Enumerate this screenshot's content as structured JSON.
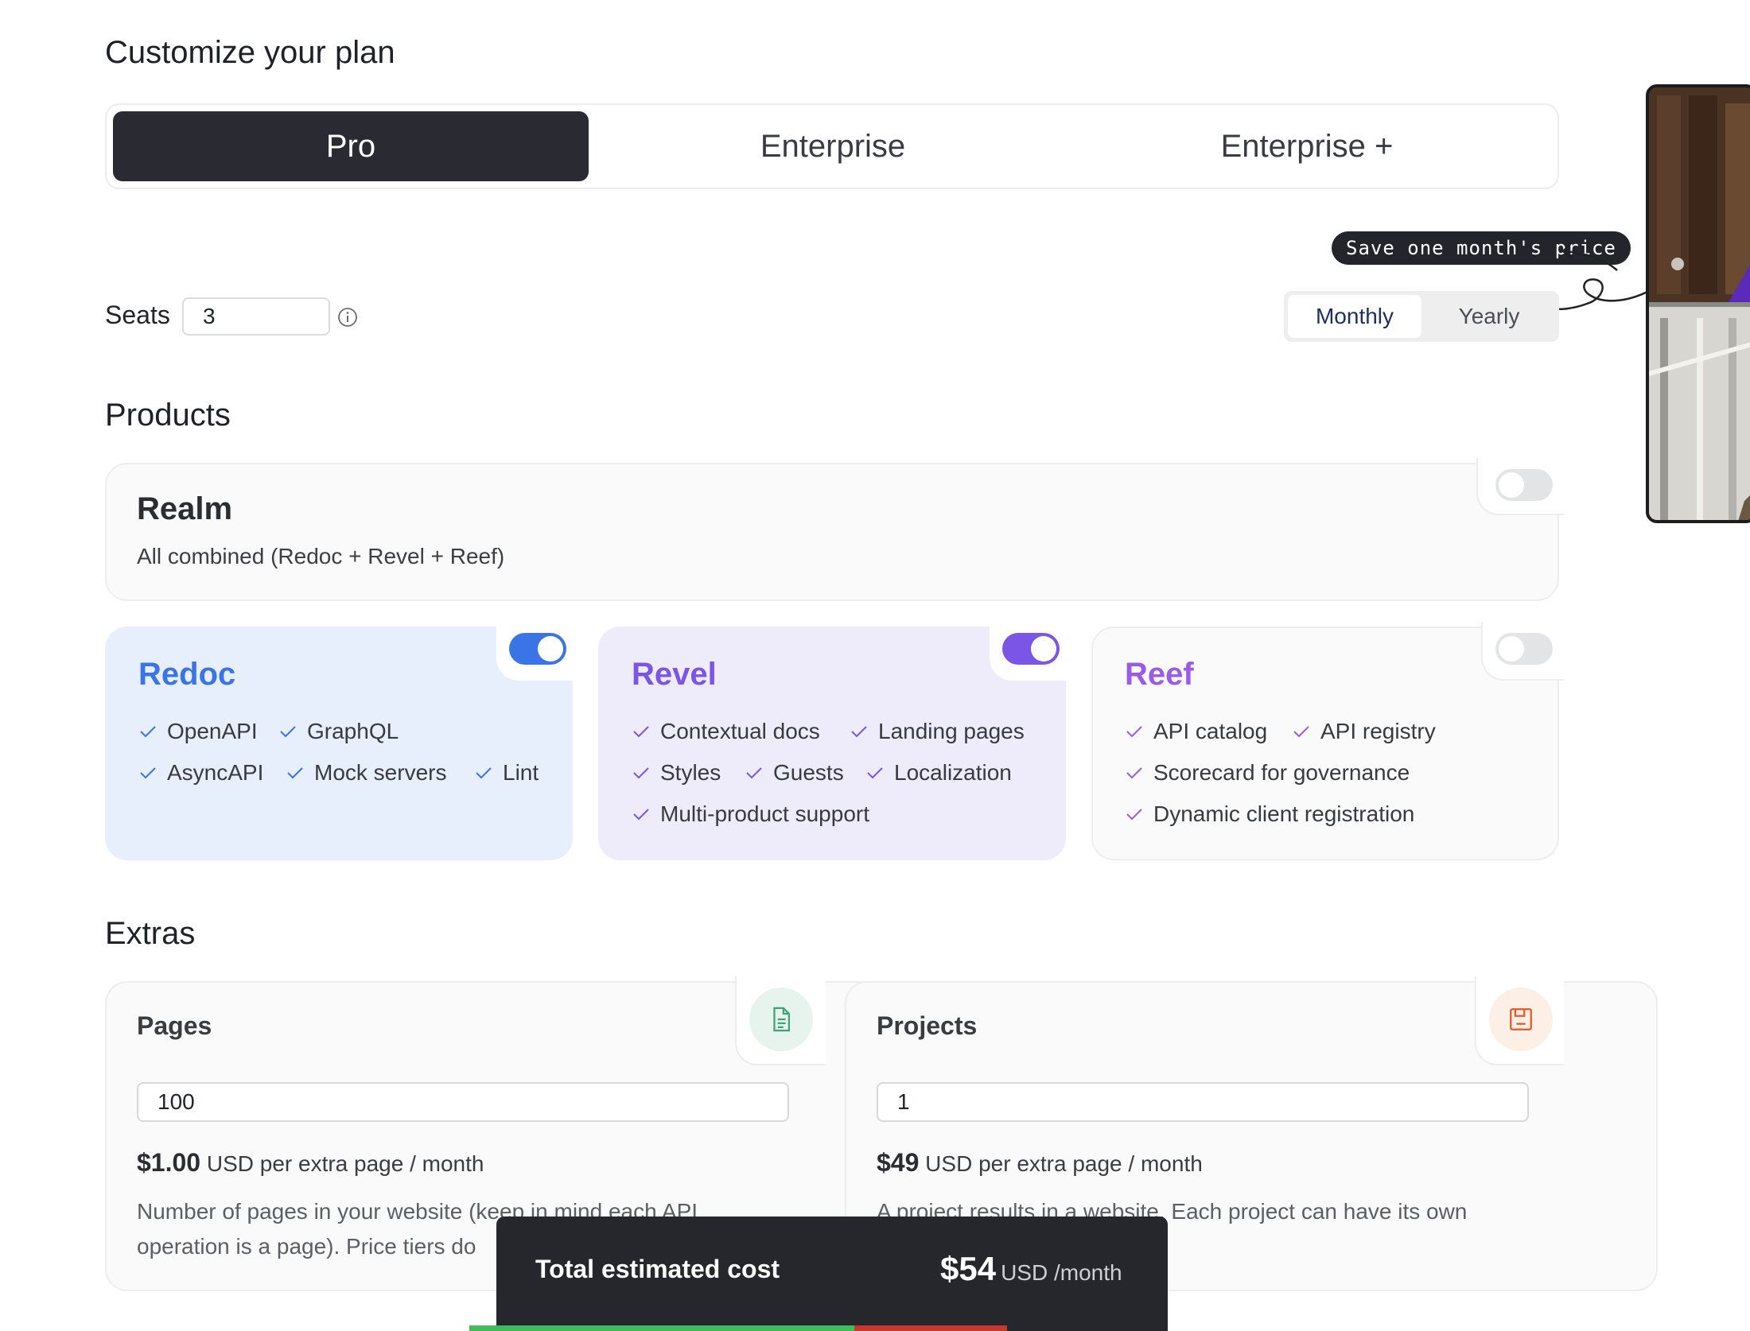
{
  "page": {
    "title": "Customize your plan"
  },
  "plan_tabs": [
    {
      "label": "Pro",
      "active": true
    },
    {
      "label": "Enterprise",
      "active": false
    },
    {
      "label": "Enterprise +",
      "active": false
    }
  ],
  "seats": {
    "label": "Seats",
    "value": "3"
  },
  "billing": {
    "badge": "Save one month's price",
    "options": [
      {
        "label": "Monthly",
        "active": true
      },
      {
        "label": "Yearly",
        "active": false
      }
    ]
  },
  "products": {
    "heading": "Products",
    "realm": {
      "title": "Realm",
      "subtitle": "All combined (Redoc + Revel + Reef)",
      "enabled": false
    },
    "cards": [
      {
        "title": "Redoc",
        "enabled": true,
        "accent": "#3b74e6",
        "background": "#e6effb",
        "features": [
          "OpenAPI",
          "GraphQL",
          "AsyncAPI",
          "Mock servers",
          "Lint"
        ]
      },
      {
        "title": "Revel",
        "enabled": true,
        "accent": "#7b55e6",
        "background": "#eeebfb",
        "features": [
          "Contextual docs",
          "Landing pages",
          "Styles",
          "Guests",
          "Localization",
          "Multi-product support"
        ]
      },
      {
        "title": "Reef",
        "enabled": false,
        "accent": "#9a5be8",
        "background": "#fafafa",
        "features": [
          "API catalog",
          "API registry",
          "Scorecard for governance",
          "Dynamic client registration"
        ]
      }
    ]
  },
  "extras": {
    "heading": "Extras",
    "pages": {
      "title": "Pages",
      "value": "100",
      "price": "$1.00",
      "price_unit": "USD per extra page / month",
      "description_line1": "Number of pages in your website (keep in mind each API",
      "description_line2": "operation is a page). Price tiers do",
      "icon": "document-icon",
      "icon_color": "#3fa27a"
    },
    "projects": {
      "title": "Projects",
      "value": "1",
      "price": "$49",
      "price_unit": "USD per extra page / month",
      "description_line1": "A project results in a website. Each project can have its own",
      "icon": "floppy-icon",
      "icon_color": "#e1582c"
    }
  },
  "total": {
    "label": "Total estimated cost",
    "amount": "$54",
    "unit": "USD /month"
  }
}
